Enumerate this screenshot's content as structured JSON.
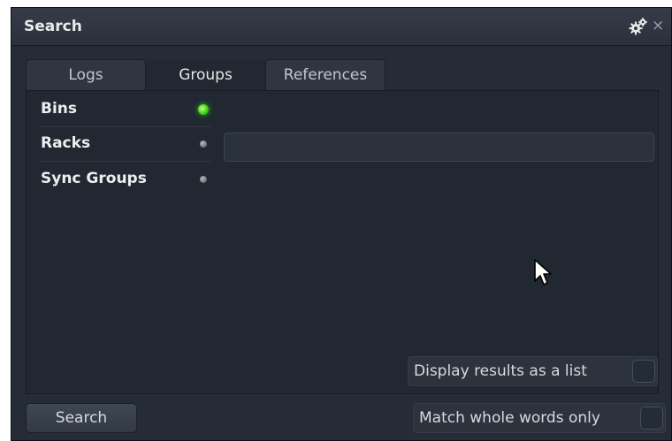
{
  "window": {
    "title": "Search",
    "icons": {
      "settings": "gear-icon",
      "close": "close-icon",
      "close_glyph": "×"
    }
  },
  "tabs": [
    {
      "label": "Logs",
      "active": false
    },
    {
      "label": "Groups",
      "active": true
    },
    {
      "label": "References",
      "active": false
    }
  ],
  "groups": {
    "rows": [
      {
        "label": "Bins",
        "enabled": true
      },
      {
        "label": "Racks",
        "enabled": false
      },
      {
        "label": "Sync Groups",
        "enabled": false
      }
    ],
    "filter_value": ""
  },
  "options": {
    "display_as_list": {
      "label": "Display results as a list",
      "checked": false
    },
    "match_whole_words": {
      "label": "Match whole words only",
      "checked": false
    }
  },
  "actions": {
    "search_label": "Search"
  },
  "colors": {
    "window_bg": "#262c36",
    "panel_bg": "#222831",
    "led_on": "#3fd41a",
    "text": "#d6dade"
  }
}
